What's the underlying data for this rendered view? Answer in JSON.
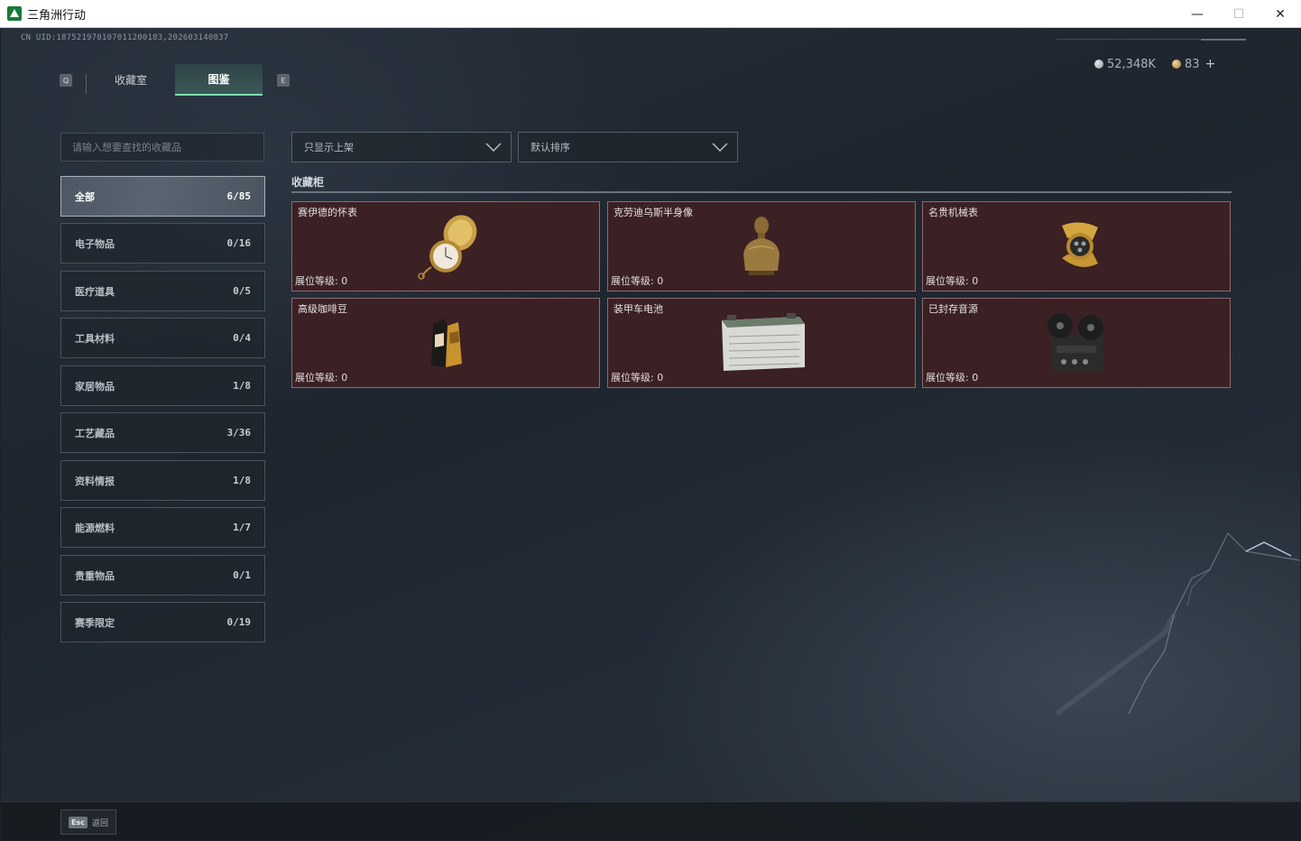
{
  "window": {
    "title": "三角洲行动",
    "minimize": "—",
    "maximize": "☐",
    "close": "✕"
  },
  "header": {
    "uid": "CN UID:18752197010701120018З,202603140837",
    "currency": {
      "silver": "52,348K",
      "gold": "83"
    },
    "tab_key_left": "Q",
    "tab_key_right": "E",
    "tabs": [
      {
        "label": "收藏室"
      },
      {
        "label": "图鉴"
      }
    ]
  },
  "search": {
    "placeholder": "请输入想要查找的收藏品"
  },
  "categories": [
    {
      "name": "全部",
      "count": "6/85"
    },
    {
      "name": "电子物品",
      "count": "0/16"
    },
    {
      "name": "医疗道具",
      "count": "0/5"
    },
    {
      "name": "工具材料",
      "count": "0/4"
    },
    {
      "name": "家居物品",
      "count": "1/8"
    },
    {
      "name": "工艺藏品",
      "count": "3/36"
    },
    {
      "name": "资料情报",
      "count": "1/8"
    },
    {
      "name": "能源燃料",
      "count": "1/7"
    },
    {
      "name": "贵重物品",
      "count": "0/1"
    },
    {
      "name": "赛季限定",
      "count": "0/19"
    }
  ],
  "filters": {
    "shelf": "只显示上架",
    "sort": "默认排序"
  },
  "section": {
    "title": "收藏柜"
  },
  "items": [
    {
      "name": "赛伊德的怀表",
      "level": "展位等级: 0",
      "icon": "pocket-watch-icon"
    },
    {
      "name": "克劳迪乌斯半身像",
      "level": "展位等级: 0",
      "icon": "bust-statue-icon"
    },
    {
      "name": "名贵机械表",
      "level": "展位等级: 0",
      "icon": "wristwatch-icon"
    },
    {
      "name": "高级咖啡豆",
      "level": "展位等级: 0",
      "icon": "coffee-bag-icon"
    },
    {
      "name": "装甲车电池",
      "level": "展位等级: 0",
      "icon": "battery-icon"
    },
    {
      "name": "已封存音源",
      "level": "展位等级: 0",
      "icon": "reel-recorder-icon"
    }
  ],
  "footer": {
    "esc_key": "Esc",
    "esc_label": "返回"
  },
  "colors": {
    "accent": "#7de0b0",
    "card_bg": "#3b2024",
    "card_border": "#8c6c70"
  }
}
